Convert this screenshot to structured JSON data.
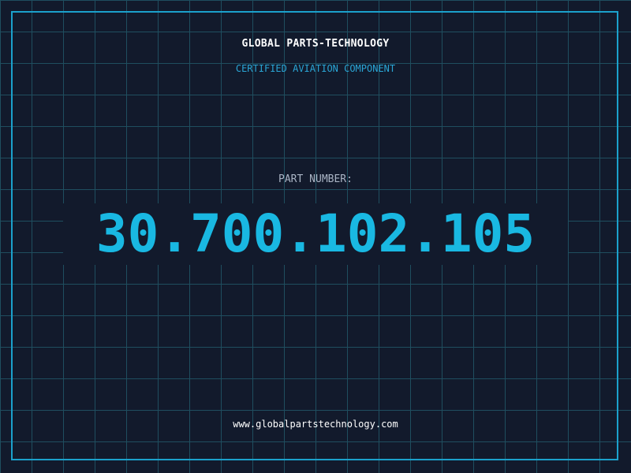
{
  "header": {
    "title": "GLOBAL PARTS-TECHNOLOGY",
    "subtitle": "CERTIFIED AVIATION COMPONENT"
  },
  "part": {
    "label": "PART NUMBER:",
    "number": "30.700.102.105"
  },
  "footer": {
    "url": "www.globalpartstechnology.com"
  },
  "colors": {
    "background": "#121a2c",
    "grid": "#1f4e5f",
    "accent": "#19b8e2",
    "frame": "#1ba1cc",
    "label": "#a9b4c4",
    "text": "#ffffff"
  }
}
